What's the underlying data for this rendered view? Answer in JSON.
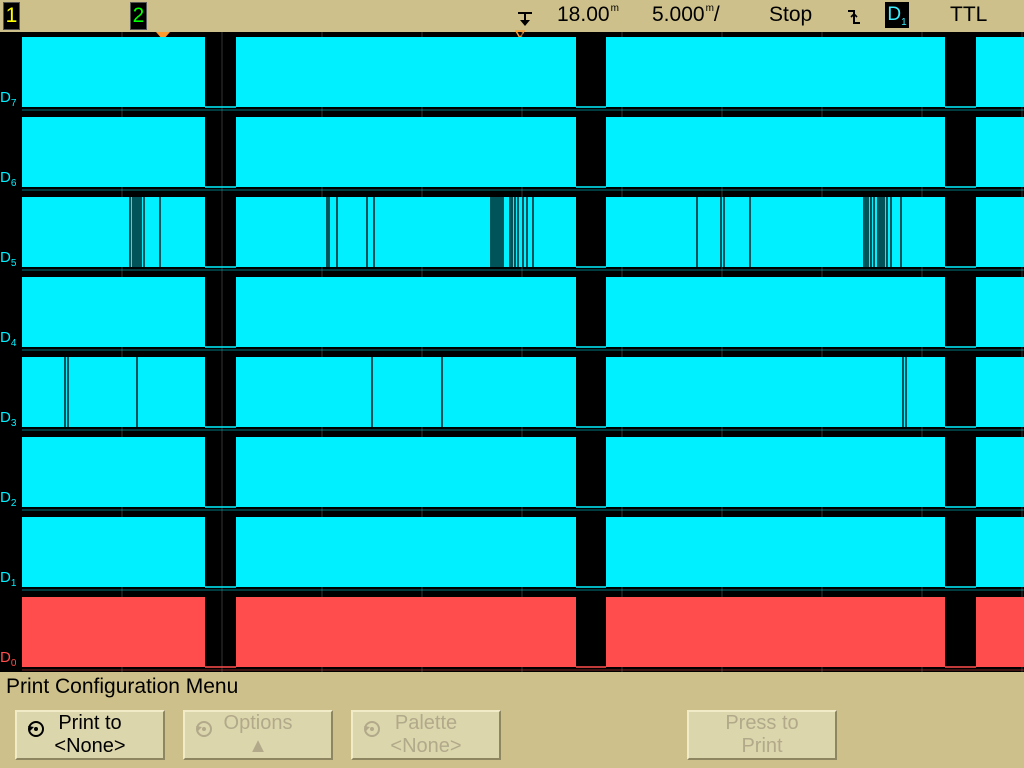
{
  "statusbar": {
    "channel1": "1",
    "channel2": "2",
    "delay": "18.00",
    "delay_unit": "m",
    "timebase": "5.000",
    "timebase_unit": "m",
    "timebase_suffix": "/",
    "run_state": "Stop",
    "trigger_source": "D",
    "trigger_source_sub": "1",
    "threshold": "TTL"
  },
  "channels": [
    {
      "name": "D",
      "sub": "7",
      "color": "#00f0ff"
    },
    {
      "name": "D",
      "sub": "6",
      "color": "#00f0ff"
    },
    {
      "name": "D",
      "sub": "5",
      "color": "#00f0ff"
    },
    {
      "name": "D",
      "sub": "4",
      "color": "#00f0ff"
    },
    {
      "name": "D",
      "sub": "3",
      "color": "#00f0ff"
    },
    {
      "name": "D",
      "sub": "2",
      "color": "#00f0ff"
    },
    {
      "name": "D",
      "sub": "1",
      "color": "#00f0ff"
    },
    {
      "name": "D",
      "sub": "0",
      "color": "#ff4d4d"
    }
  ],
  "menu": {
    "title": "Print Configuration Menu",
    "softkeys": [
      {
        "line1": "Print to",
        "line2": "<None>",
        "enabled": true
      },
      {
        "line1": "Options",
        "line2": "▲",
        "enabled": false
      },
      {
        "line1": "Palette",
        "line2": "<None>",
        "enabled": false
      },
      {
        "line1": "Press to",
        "line2": "Print",
        "enabled": false
      }
    ]
  },
  "colors": {
    "panel": "#cdc08a",
    "channel1": "#ffff00",
    "channel2": "#00ff00",
    "digital": "#00f0ff",
    "d0": "#ff4d4d",
    "marker": "#ff9a2e"
  }
}
